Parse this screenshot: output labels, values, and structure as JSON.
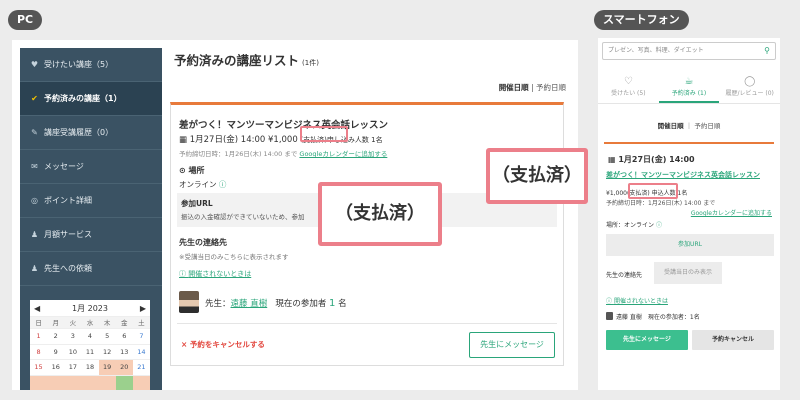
{
  "labels": {
    "pc": "PC",
    "smartphone": "スマートフォン"
  },
  "sidebar": {
    "items": [
      {
        "icon": "heart-icon",
        "glyph": "♥",
        "label": "受けたい講座（5）"
      },
      {
        "icon": "check-circle-icon",
        "glyph": "✔",
        "label": "予約済みの講座（1）"
      },
      {
        "icon": "pencil-icon",
        "glyph": "✎",
        "label": "講座受講履歴（0）"
      },
      {
        "icon": "mail-icon",
        "glyph": "✉",
        "label": "メッセージ"
      },
      {
        "icon": "coin-icon",
        "glyph": "◎",
        "label": "ポイント詳細"
      },
      {
        "icon": "people-icon",
        "glyph": "♟",
        "label": "月額サービス"
      },
      {
        "icon": "people-icon",
        "glyph": "♟",
        "label": "先生への依頼"
      }
    ]
  },
  "calendar": {
    "month": "1月 2023",
    "prev": "◀",
    "next": "▶",
    "weekdays": [
      "日",
      "月",
      "火",
      "水",
      "木",
      "金",
      "土"
    ],
    "rows": [
      [
        "1",
        "2",
        "3",
        "4",
        "5",
        "6",
        "7"
      ],
      [
        "8",
        "9",
        "10",
        "11",
        "12",
        "13",
        "14"
      ],
      [
        "15",
        "16",
        "17",
        "18",
        "19",
        "20",
        "21"
      ],
      [
        "",
        "",
        "",
        "",
        "",
        "",
        ""
      ]
    ]
  },
  "main": {
    "title": "予約済みの講座リスト",
    "count": "(1件)",
    "sort": {
      "active": "開催日順",
      "separator": "|",
      "other": "予約日順"
    }
  },
  "card": {
    "title": "差がつく！マンツーマンビジネス英会話レッスン",
    "date": "1月27日(金) 14:00",
    "price": "¥1,000",
    "status": "(支払済)",
    "applicants": "申し込み人数 1名",
    "deadline": "予約締切日時：1月26日(木) 14:00 まで",
    "gcal": "Googleカレンダーに追加する",
    "place_title": "場所",
    "place_value": "オンライン",
    "url_title": "参加URL",
    "url_text": "振込の入金確認ができていないため、参加",
    "contact_title": "先生の連絡先",
    "contact_text": "※受講当日のみこちらに表示されます",
    "help": "開催されないときは",
    "teacher_prefix": "先生：",
    "teacher_name": "遠藤 直樹",
    "participants_label": "現在の参加者",
    "participants_count": "1",
    "participants_unit": "名",
    "cancel": "× 予約をキャンセルする",
    "message_button": "先生にメッセージ"
  },
  "callout": {
    "text": "（支払済）"
  },
  "sp": {
    "search_placeholder": "プレゼン、写真、料理、ダイエット",
    "tabs": [
      {
        "icon": "heart-outline-icon",
        "glyph": "♡",
        "label": "受けたい (5)"
      },
      {
        "icon": "teapot-icon",
        "glyph": "☕",
        "label": "予約済み (1)"
      },
      {
        "icon": "speech-bubble-icon",
        "glyph": "◯",
        "label": "履歴/レビュー (0)"
      }
    ],
    "sort": {
      "active": "開催日順",
      "other": "予約日順"
    },
    "date": "1月27日(金) 14:00",
    "title": "差がつく！マンツーマンビジネス英会話レッスン",
    "price": "¥1,000",
    "status": "(支払済)",
    "applicants": "申込人数 1名",
    "deadline": "予約締切日時：1月26日(木) 14:00 まで",
    "gcal": "Googleカレンダーに追加する",
    "place": "場所：オンライン",
    "url_button": "参加URL",
    "contact_label": "先生の連絡先",
    "contact_value": "受講当日のみ表示",
    "help": "開催されないときは",
    "teacher": "遠藤 直樹　現在の参加者：1名",
    "message_button": "先生にメッセージ",
    "cancel_button": "予約キャンセル"
  },
  "colors": {
    "accent": "#2aa57a",
    "sidebar": "#3a5263",
    "highlight": "#ec7f8a",
    "danger": "#e2453c",
    "card_top": "#e87a3b"
  }
}
